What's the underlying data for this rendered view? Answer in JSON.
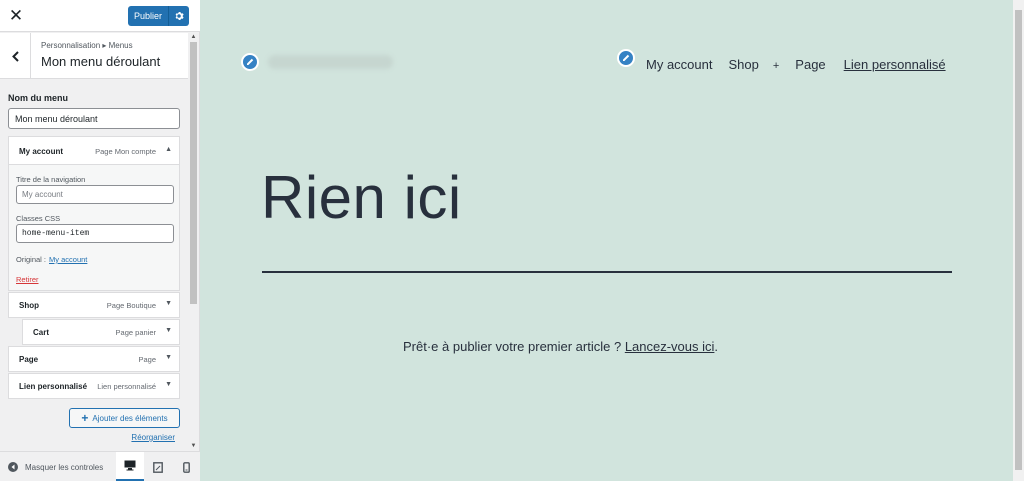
{
  "header": {
    "close_icon": "close-icon",
    "publish_label": "Publier",
    "gear_icon": "gear-icon"
  },
  "section": {
    "back_icon": "chevron-left-icon",
    "breadcrumb": "Personnalisation ▸ Menus",
    "title": "Mon menu déroulant"
  },
  "menu_name": {
    "label": "Nom du menu",
    "value": "Mon menu déroulant"
  },
  "open_item": {
    "title": "My account",
    "type": "Page Mon compte",
    "nav_title_label": "Titre de la navigation",
    "nav_title_placeholder": "My account",
    "css_label": "Classes CSS",
    "css_value": "home-menu-item",
    "original_label": "Original :",
    "original_link": "My account",
    "remove_label": "Retirer"
  },
  "menu_items": [
    {
      "title": "Shop",
      "type": "Page Boutique"
    },
    {
      "title": "Cart",
      "type": "Page panier"
    },
    {
      "title": "Page",
      "type": "Page"
    },
    {
      "title": "Lien personnalisé",
      "type": "Lien personnalisé"
    }
  ],
  "add_items_label": "Ajouter des éléments",
  "reorder_label": "Réorganiser",
  "footer": {
    "collapse_label": "Masquer les controles",
    "devices": [
      "desktop-icon",
      "tablet-icon",
      "mobile-icon"
    ]
  },
  "preview": {
    "nav": [
      "My account",
      "Shop",
      "+",
      "Page",
      "Lien personnalisé"
    ],
    "title": "Rien ici",
    "message": "Prêt·e à publier votre premier article ? ",
    "message_link": "Lancez-vous ici",
    "message_end": ".",
    "background": "#d1e4dd"
  },
  "colors": {
    "accent": "#2271b1",
    "danger": "#d63638",
    "pencil": "#3582c4"
  }
}
